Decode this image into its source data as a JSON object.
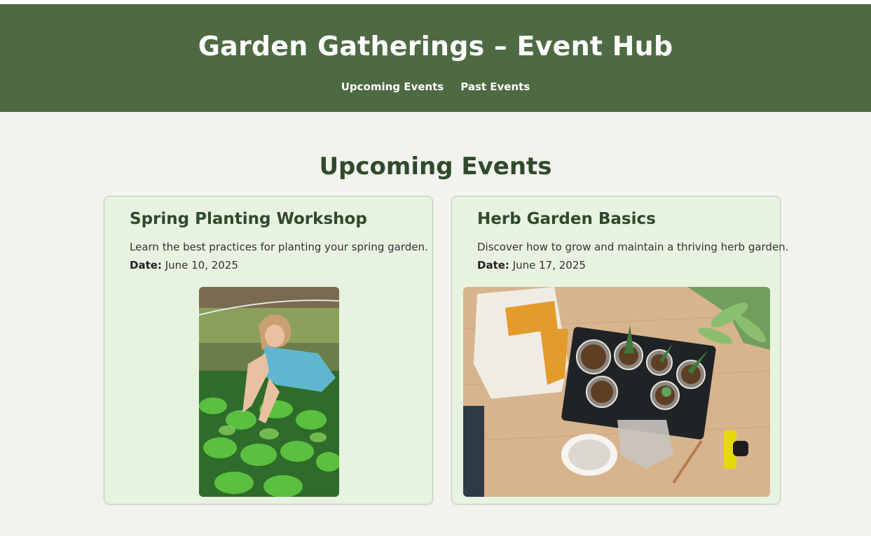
{
  "header": {
    "title": "Garden Gatherings – Event Hub",
    "nav": [
      {
        "label": "Upcoming Events"
      },
      {
        "label": "Past Events"
      }
    ]
  },
  "main": {
    "section_title": "Upcoming Events",
    "events": [
      {
        "title": "Spring Planting Workshop",
        "description": "Learn the best practices for planting your spring garden.",
        "date_label": "Date:",
        "date": "June 10, 2025",
        "image": "woman-tending-seedlings-photo"
      },
      {
        "title": "Herb Garden Basics",
        "description": "Discover how to grow and maintain a thriving herb garden.",
        "date_label": "Date:",
        "date": "June 17, 2025",
        "image": "potting-supplies-on-wood-floor-photo"
      }
    ]
  },
  "colors": {
    "header_bg": "#4d6a43",
    "page_bg": "#f3f3ee",
    "card_bg": "#e8f2e1",
    "heading": "#2f4a2b"
  }
}
